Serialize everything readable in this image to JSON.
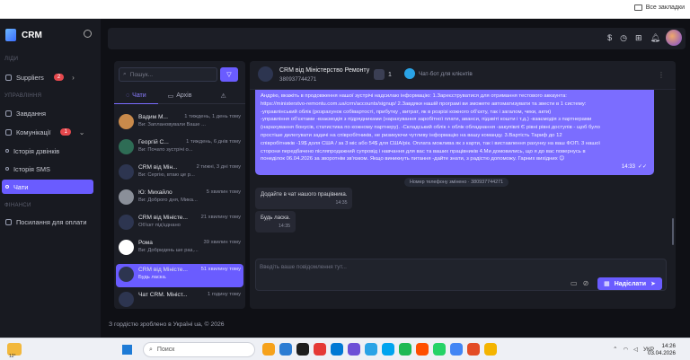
{
  "browser": {
    "bookmarks_all": "Все закладки"
  },
  "sidebar": {
    "brand": "CRM",
    "sections": {
      "lidy": "ЛІДИ",
      "upravlinnia": "УПРАВЛІННЯ",
      "finansy": "ФІНАНСИ"
    },
    "items": [
      {
        "label": "Suppliers",
        "badge": "2"
      },
      {
        "label": "Завдання"
      },
      {
        "label": "Комунікації",
        "badge": "1"
      },
      {
        "label": "Історія дзвінків"
      },
      {
        "label": "Історія SMS"
      },
      {
        "label": "Чати"
      },
      {
        "label": "Посилання для оплати"
      }
    ]
  },
  "topbar": {
    "icons": [
      "dollar-icon",
      "history-icon",
      "grid-icon",
      "bell-icon"
    ]
  },
  "chatlist": {
    "search_placeholder": "Пошук...",
    "tabs": [
      {
        "label": "Чати"
      },
      {
        "label": "Архів"
      },
      {
        "label": "⚠"
      }
    ],
    "rows": [
      {
        "name": "Вадим М...",
        "time": "1 тиждень, 1 день тому",
        "msg": "Ви: Заплановували Ваше ...",
        "color": "#c98a4b"
      },
      {
        "name": "Георгій С...",
        "time": "1 тиждень, 6 днів тому",
        "msg": "Ви: Почато зустрічі о...",
        "color": "#2e6c55"
      },
      {
        "name": "CRM від Мін...",
        "time": "2 тижні, 3 дні тому",
        "msg": "Ви: Сергію, втаю це р...",
        "color": "#2d3550"
      },
      {
        "name": "Ю: Михайло",
        "time": "5 хвилин тому",
        "msg": "Ви: Доброго дня, Мика...",
        "color": "#8a8f99"
      },
      {
        "name": "CRM від Міністе...",
        "time": "21 хвилину тому",
        "msg": "Об'єкт під'єднано",
        "color": "#2d3550"
      },
      {
        "name": "Рома",
        "time": "39 хвилин тому",
        "msg": "Ви: Добридень ше раз,...",
        "color": "#ffffff"
      },
      {
        "name": "CRM від Міністе...",
        "time": "51 хвилину тому",
        "msg": "Будь ласка.",
        "color": "#2d3550"
      },
      {
        "name": "Чат CRM. Мініст...",
        "time": "1 годину тому",
        "msg": "",
        "color": "#2d3550"
      }
    ]
  },
  "chat": {
    "name": "CRM від Міністерство Ремонту",
    "phone": "380937744271",
    "count": "1",
    "bot_label": "Чат-бот для клієнтів",
    "out_lines": [
      "Андрію, вкажіть в продовження нашої зустрічі надсилаю інформацію: 1.Зареєструватися для отримання тестового аккаунта: ",
      "https://ministerstvo-remontu.com.ua/crm/accounts/signup/ 2.Завдяки нашій програмі ви зможете автоматизувати та звести в 1 систему:",
      "-управлінський облік (розрахунок собівартості, прибутку , витрат, як в розрізі кожного об'єкту, так і загалом, чеки, акти)",
      "-управління об'єктами -взаємодія з підрядниками (нарахування заробітної плати, аванси, підзвіті кошти і т.д.) -взаємодія з партнерами",
      "(нарахування бонусів, статистика по кожному партнеру). -Складський облік + облік обладнання -закупівлі Є рівні рівні доступів - щоб було",
      "простіше делегувати задачі на співробітників, не ризикуючи чутливу інформацію на вашу команду. 3.Вартість Тариф до 12",
      "співробітників -19$ доля США / за 3 міс або 54$ для США/рік. Оплата можлива як з карти, так і виставлення рахунку на ваш ФОП. 3 нашої",
      "сторони передбачено післяпродажний супровід і навчання для вас та ваших працівників 4.Ми домовились, що я до вас повернусь в",
      "понеділок 06.04.2026 за зворотнім зв'язком. Якщо виникнуть питання -дайте знати, з радістю допоможу. Гарних вихідних 😊"
    ],
    "out_time": "14:33",
    "system_msg": "Номер телефону змінено · 380937744271",
    "in_msgs": [
      {
        "text": "Додайте в чат нашого працівника.",
        "time": "14:35"
      },
      {
        "text": "Будь ласка.",
        "time": "14:35"
      }
    ],
    "composer_placeholder": "Введіть ваше повідомлення тут...",
    "send_label": "Надіслати"
  },
  "footer": "З гордістю зроблено в Україні ua, © 2026",
  "taskbar": {
    "weather": "12°",
    "search": "Поиск",
    "lang": "УКР",
    "time": "14:26",
    "date": "03.04.2026",
    "app_colors": [
      "#f6a21b",
      "#2b7cd3",
      "#1d1d1d",
      "#e53935",
      "#0078d4",
      "#6c4fd6",
      "#2aa3e6",
      "#00a4ef",
      "#1db954",
      "#ff4f00",
      "#25d366",
      "#4285f4",
      "#e34c26",
      "#f4b400"
    ]
  }
}
